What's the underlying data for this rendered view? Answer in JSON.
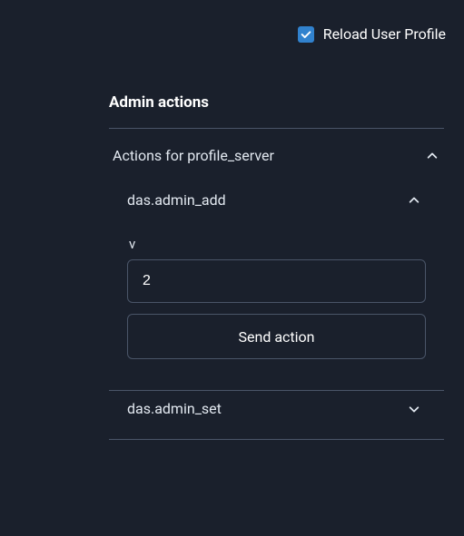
{
  "reload": {
    "label": "Reload User Profile",
    "checked": true
  },
  "panel": {
    "title": "Admin actions",
    "accordion": {
      "label": "Actions for profile_server",
      "expanded": true,
      "items": [
        {
          "label": "das.admin_add",
          "expanded": true,
          "field_label": "v",
          "field_value": "2",
          "button_label": "Send action"
        },
        {
          "label": "das.admin_set",
          "expanded": false
        }
      ]
    }
  }
}
